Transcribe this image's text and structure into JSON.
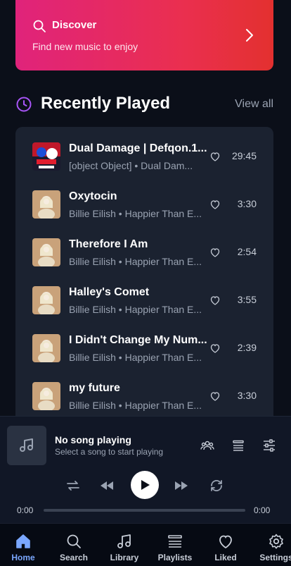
{
  "discover": {
    "title": "Discover",
    "subtitle": "Find new music to enjoy"
  },
  "recent": {
    "title": "Recently Played",
    "view_all": "View all",
    "tracks": [
      {
        "title": "Dual Damage | Defqon.1...",
        "subtitle": "[object Object] • Dual Dam...",
        "duration": "29:45",
        "art": "defqon"
      },
      {
        "title": "Oxytocin",
        "subtitle": "Billie Eilish • Happier Than E...",
        "duration": "3:30",
        "art": "billie"
      },
      {
        "title": "Therefore I Am",
        "subtitle": "Billie Eilish • Happier Than E...",
        "duration": "2:54",
        "art": "billie"
      },
      {
        "title": "Halley's Comet",
        "subtitle": "Billie Eilish • Happier Than E...",
        "duration": "3:55",
        "art": "billie"
      },
      {
        "title": "I Didn't Change My Num...",
        "subtitle": "Billie Eilish • Happier Than E...",
        "duration": "2:39",
        "art": "billie"
      },
      {
        "title": "my future",
        "subtitle": "Billie Eilish • Happier Than E...",
        "duration": "3:30",
        "art": "billie"
      }
    ]
  },
  "player": {
    "title": "No song playing",
    "subtitle": "Select a song to start playing",
    "time_current": "0:00",
    "time_total": "0:00",
    "progress": 0
  },
  "nav": {
    "items": [
      {
        "label": "Home",
        "icon": "home-icon",
        "active": true
      },
      {
        "label": "Search",
        "icon": "search-icon",
        "active": false
      },
      {
        "label": "Library",
        "icon": "music-note-icon",
        "active": false
      },
      {
        "label": "Playlists",
        "icon": "list-icon",
        "active": false
      },
      {
        "label": "Liked",
        "icon": "heart-icon",
        "active": false
      },
      {
        "label": "Settings",
        "icon": "gear-icon",
        "active": false
      }
    ]
  },
  "colors": {
    "accent_pink": "#e0237b",
    "accent_red": "#e3302f",
    "active_nav": "#7aa7ff",
    "clock_purple": "#a855f7"
  }
}
